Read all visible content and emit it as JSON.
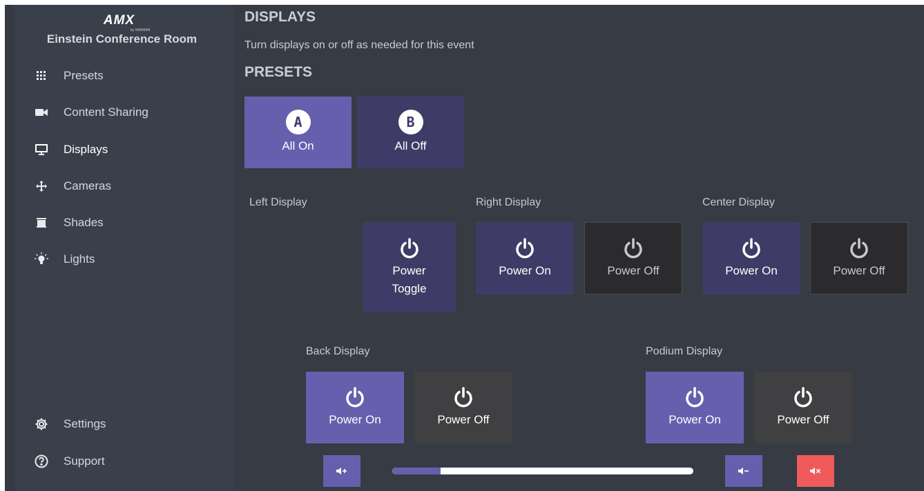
{
  "sidebar": {
    "logo": "AMX",
    "logo_sub": "by HARMAN",
    "room_name": "Einstein Conference Room",
    "items": [
      {
        "label": "Presets",
        "icon": "grid-icon"
      },
      {
        "label": "Content Sharing",
        "icon": "video-icon"
      },
      {
        "label": "Displays",
        "icon": "monitor-icon",
        "active": true
      },
      {
        "label": "Cameras",
        "icon": "move-arrows-icon"
      },
      {
        "label": "Shades",
        "icon": "shades-icon"
      },
      {
        "label": "Lights",
        "icon": "bulb-icon"
      }
    ],
    "footer_items": [
      {
        "label": "Settings",
        "icon": "gear-icon"
      },
      {
        "label": "Support",
        "icon": "question-circle-icon"
      }
    ]
  },
  "main": {
    "title": "DISPLAYS",
    "subtitle": "Turn displays on or off as needed for this event",
    "presets_title": "PRESETS",
    "presets": [
      {
        "badge": "A",
        "label": "All On"
      },
      {
        "badge": "B",
        "label": "All Off"
      }
    ],
    "displays": {
      "left": {
        "label": "Left Display",
        "toggle_line1": "Power",
        "toggle_line2": "Toggle"
      },
      "right": {
        "label": "Right Display",
        "on": "Power On",
        "off": "Power Off"
      },
      "center": {
        "label": "Center Display",
        "on": "Power On",
        "off": "Power Off"
      },
      "back": {
        "label": "Back Display",
        "on": "Power On",
        "off": "Power Off"
      },
      "podium": {
        "label": "Podium Display",
        "on": "Power On",
        "off": "Power Off"
      }
    },
    "volume": {
      "level_fraction": 0.16
    }
  },
  "colors": {
    "accent": "#6560ad",
    "accent_dark": "#3e3c66",
    "mute": "#f05a5a",
    "background": "#363b44",
    "sidebar": "#3a404b"
  }
}
